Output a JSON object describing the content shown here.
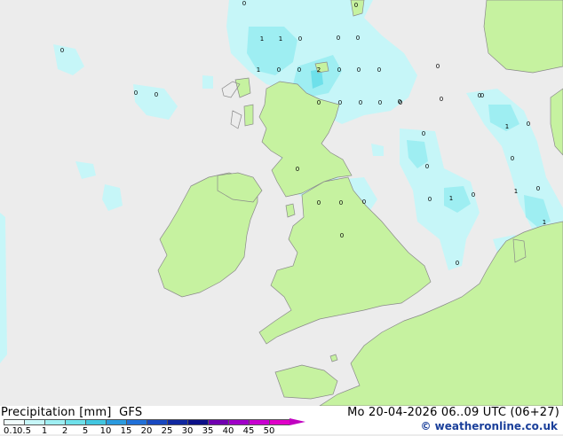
{
  "footer": {
    "title": "Precipitation [mm]  GFS",
    "valid_time": "Mo 20-04-2026 06..09 UTC (06+27)",
    "credit": "© weatheronline.co.uk"
  },
  "legend": {
    "ticks": [
      "0.1",
      "0.5",
      "1",
      "2",
      "5",
      "10",
      "15",
      "20",
      "25",
      "30",
      "35",
      "40",
      "45",
      "50"
    ],
    "colors": [
      "#f0fcfc",
      "#c6f6f8",
      "#9eeef2",
      "#6ee0ea",
      "#42c6e0",
      "#2a9ade",
      "#2070d8",
      "#1848c0",
      "#1028a0",
      "#0c1088",
      "#7000b0",
      "#a000c8",
      "#c800d0",
      "#e000c8"
    ]
  },
  "map": {
    "sea_color": "#ececec",
    "land_color": "#c6f2a0",
    "precip_colors": [
      "#c6f6f8",
      "#9eeef2",
      "#6ee0ea"
    ],
    "grid_values": [
      "0",
      "1",
      "1",
      "0",
      "0",
      "0",
      "1",
      "0",
      "0",
      "2",
      "0",
      "0",
      "0",
      "0",
      "0",
      "0",
      "0",
      "0",
      "0",
      "0",
      "0",
      "0",
      "0",
      "0",
      "0",
      "0",
      "0",
      "0",
      "0",
      "1",
      "0",
      "0",
      "1",
      "0",
      "0",
      "1",
      "0",
      "0",
      "0",
      "0",
      "1",
      "0",
      "0",
      "0"
    ]
  }
}
